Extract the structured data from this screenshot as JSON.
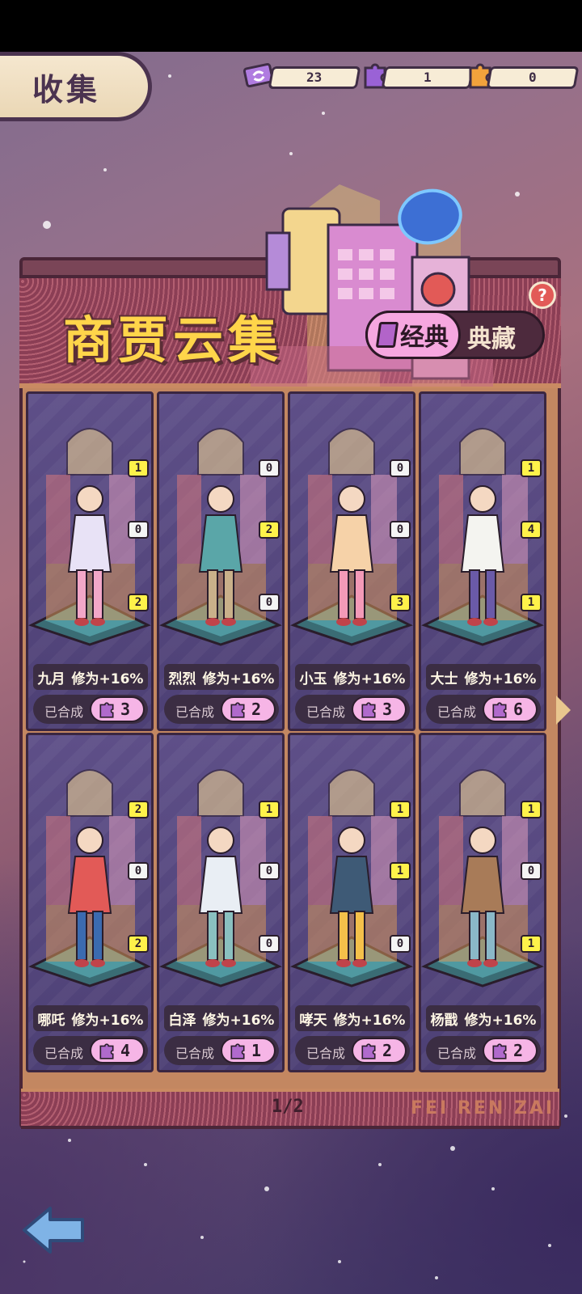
{
  "header": {
    "title": "收集"
  },
  "resources": [
    {
      "icon": "ticket-icon",
      "value": "23"
    },
    {
      "icon": "purple-puzzle-icon",
      "value": "1"
    },
    {
      "icon": "orange-puzzle-icon",
      "value": "0"
    }
  ],
  "collection": {
    "title": "商贾云集",
    "toggle": {
      "active": "经典",
      "inactive": "典藏"
    },
    "help": "?",
    "brand": "FEI REN ZAI",
    "page": "1/2"
  },
  "cards": [
    {
      "name": "九月",
      "bonus": "修为+16%",
      "status": "已合成",
      "count": "3",
      "levels": [
        "1",
        "0",
        "2"
      ],
      "color": "#e8e2f6",
      "accent": "#f2a7c8"
    },
    {
      "name": "烈烈",
      "bonus": "修为+16%",
      "status": "已合成",
      "count": "2",
      "levels": [
        "0",
        "2",
        "0"
      ],
      "color": "#5aa6a8",
      "accent": "#c9b08a"
    },
    {
      "name": "小玉",
      "bonus": "修为+16%",
      "status": "已合成",
      "count": "3",
      "levels": [
        "0",
        "0",
        "3"
      ],
      "color": "#f6d2a8",
      "accent": "#f39ab8"
    },
    {
      "name": "大士",
      "bonus": "修为+16%",
      "status": "已合成",
      "count": "6",
      "levels": [
        "1",
        "4",
        "1"
      ],
      "color": "#f4f4f0",
      "accent": "#6a5aa8"
    },
    {
      "name": "哪吒",
      "bonus": "修为+16%",
      "status": "已合成",
      "count": "4",
      "levels": [
        "2",
        "0",
        "2"
      ],
      "color": "#e25a57",
      "accent": "#3b6bb0"
    },
    {
      "name": "白泽",
      "bonus": "修为+16%",
      "status": "已合成",
      "count": "1",
      "levels": [
        "1",
        "0",
        "0"
      ],
      "color": "#e9eef4",
      "accent": "#8ac0c0"
    },
    {
      "name": "哮天",
      "bonus": "修为+16%",
      "status": "已合成",
      "count": "2",
      "levels": [
        "1",
        "1",
        "0"
      ],
      "color": "#3e5a76",
      "accent": "#f4c04a"
    },
    {
      "name": "杨戬",
      "bonus": "修为+16%",
      "status": "已合成",
      "count": "2",
      "levels": [
        "1",
        "0",
        "1"
      ],
      "color": "#a87b58",
      "accent": "#8ab8c8"
    }
  ]
}
